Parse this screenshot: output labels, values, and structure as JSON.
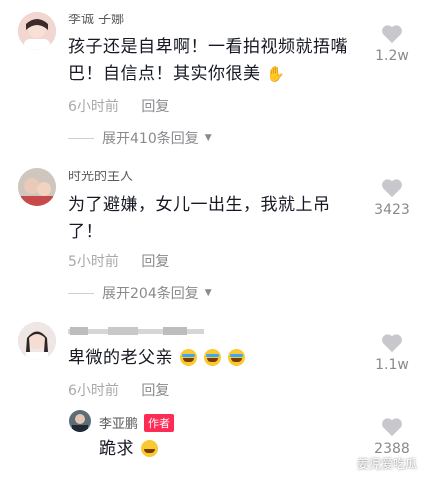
{
  "comments": [
    {
      "username": "李诚 子娜",
      "text": "孩子还是自卑啊！一看拍视频就捂嘴巴！自信点！其实你很美",
      "time": "6小时前",
      "reply_label": "回复",
      "expand_label": "展开410条回复",
      "likes": "1.2w",
      "emoji": "praying-hands"
    },
    {
      "username": "时光的主人",
      "text": "为了避嫌，女儿一出生，我就上吊了！",
      "time": "5小时前",
      "reply_label": "回复",
      "expand_label": "展开204条回复",
      "likes": "3423"
    },
    {
      "username": "",
      "text": "卑微的老父亲",
      "time": "6小时前",
      "reply_label": "回复",
      "likes": "1.1w",
      "emoji": "laugh-cry x3"
    }
  ],
  "reply": {
    "username": "李亚鹏",
    "badge": "作者",
    "text": "跪求",
    "likes": "2388",
    "emoji": "grin"
  },
  "watermark": "姜児爱吃瓜",
  "colors": {
    "like_icon": "#c7c7cc",
    "badge": "#fe2c55",
    "meta": "#a9a9ad"
  }
}
